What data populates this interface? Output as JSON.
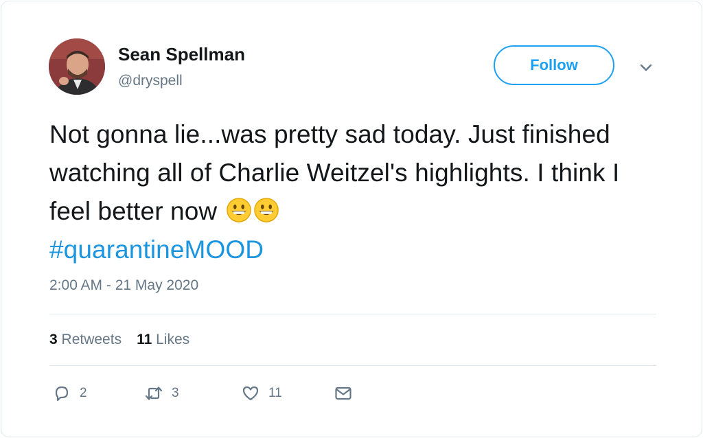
{
  "user": {
    "name": "Sean Spellman",
    "handle": "@dryspell"
  },
  "follow_label": "Follow",
  "tweet": {
    "text_main": "Not gonna lie...was pretty sad today. Just finished watching all of Charlie Weitzel's highlights. I think I feel better now",
    "hashtag": "#quarantineMOOD",
    "emoji_count": 2
  },
  "timestamp": "2:00 AM - 21 May 2020",
  "stats": {
    "retweets_count": "3",
    "retweets_label": "Retweets",
    "likes_count": "11",
    "likes_label": "Likes"
  },
  "actions": {
    "reply_count": "2",
    "retweet_count": "3",
    "like_count": "11"
  },
  "colors": {
    "accent": "#1da1f2",
    "hashtag": "#1b95e0",
    "muted": "#657786",
    "text": "#14171a",
    "border": "#e1e8ed"
  },
  "icons": [
    "reply-icon",
    "retweet-icon",
    "like-icon",
    "dm-icon",
    "chevron-down-icon",
    "grinning-face-emoji"
  ]
}
